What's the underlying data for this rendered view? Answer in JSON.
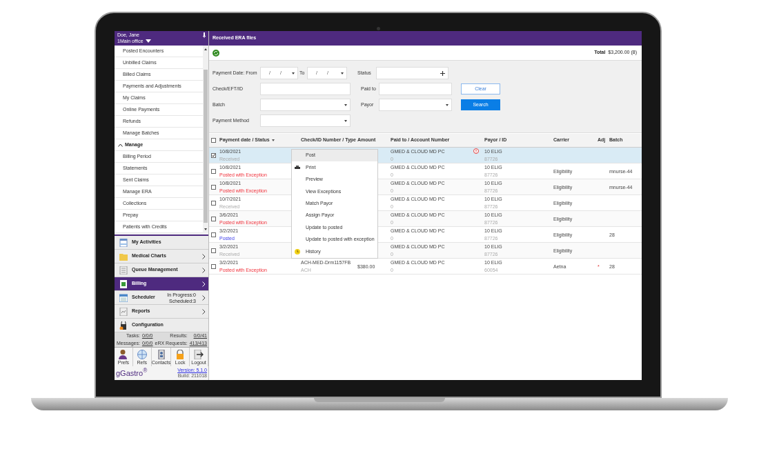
{
  "sidebar": {
    "user": "Doe, Jane",
    "office": "1Main office",
    "items": [
      {
        "kind": "item",
        "label": "Posted Encounters"
      },
      {
        "kind": "item",
        "label": "Unbilled Claims"
      },
      {
        "kind": "item",
        "label": "Billed Claims"
      },
      {
        "kind": "item",
        "label": "Payments and Adjustments"
      },
      {
        "kind": "item",
        "label": "My Claims"
      },
      {
        "kind": "item",
        "label": "Online Payments"
      },
      {
        "kind": "item",
        "label": "Refunds"
      },
      {
        "kind": "item",
        "label": "Manage Batches"
      },
      {
        "kind": "section",
        "label": "Manage",
        "expanded": true
      },
      {
        "kind": "item",
        "label": "Billing Period"
      },
      {
        "kind": "item",
        "label": "Statements"
      },
      {
        "kind": "item",
        "label": "Sent Claims"
      },
      {
        "kind": "item",
        "label": "Manage ERA"
      },
      {
        "kind": "item",
        "label": "Collections"
      },
      {
        "kind": "item",
        "label": "Prepay"
      },
      {
        "kind": "item",
        "label": "Patients with Credits"
      }
    ],
    "nav": [
      {
        "label": "My Activities",
        "selected": false,
        "arrow": false
      },
      {
        "label": "Medical Charts",
        "selected": false,
        "arrow": true
      },
      {
        "label": "Queue Management",
        "selected": false,
        "arrow": true
      },
      {
        "label": "Billing",
        "selected": true,
        "arrow": true
      },
      {
        "label": "Scheduler",
        "selected": false,
        "arrow": true,
        "in_progress": "In Progress:0",
        "scheduled": "Scheduled:3"
      },
      {
        "label": "Reports",
        "selected": false,
        "arrow": true
      },
      {
        "label": "Configuration",
        "selected": false,
        "arrow": false
      }
    ],
    "stats": [
      {
        "label": "Tasks:",
        "value": "0/0/0"
      },
      {
        "label": "Results:",
        "value": "0/0/41"
      },
      {
        "label": "Messages:",
        "value": "0/0/0"
      },
      {
        "label": "eRX Requests:",
        "value": "413/413"
      }
    ],
    "tools": [
      "Prefs",
      "Refs",
      "Contacts",
      "Lock",
      "Logout"
    ],
    "logo": "gGastro$^{®}$",
    "version": "Version: 5.1.0",
    "build": "Build: 211018"
  },
  "main": {
    "title": "Received ERA files",
    "total_label": "Total",
    "total": "$3,200.00 (8)",
    "filters": {
      "date_from_label": "Payment Date: From",
      "date_from": "/ /",
      "to_label": "To",
      "date_to": "/ /",
      "status_label": "Status",
      "check_label": "Check/EFT/ID",
      "paid_to_label": "Paid to",
      "batch_label": "Batch",
      "payor_label": "Payor",
      "method_label": "Payment Method"
    },
    "buttons": {
      "clear": "Clear",
      "search": "Search"
    },
    "all_checked": false,
    "columns": [
      "Payment date / Status",
      "Check/ID Number / Type",
      "Amount",
      "Paid to / Account Number",
      "Payor / ID",
      "Carrier",
      "Adj",
      "Batch"
    ],
    "rows": [
      {
        "checked": true,
        "date": "10/8/2021",
        "status": "Received",
        "kind": "received",
        "paid_to": "GMED & CLOUD MD PC",
        "account": "0",
        "alert": true,
        "payor": "10 ELIG",
        "payor_id": "87726"
      },
      {
        "checked": false,
        "date": "10/8/2021",
        "status": "Posted with Exception",
        "kind": "exception",
        "paid_to": "GMED & CLOUD MD PC",
        "account": "0",
        "alert": false,
        "payor": "10 ELIG",
        "payor_id": "87726",
        "carrier": "Eligibility",
        "batch": "mnurse-44"
      },
      {
        "checked": false,
        "date": "10/8/2021",
        "status": "Posted with Exception",
        "kind": "exception",
        "paid_to": "GMED & CLOUD MD PC",
        "account": "0",
        "alert": false,
        "payor": "10 ELIG",
        "payor_id": "87726",
        "carrier": "Eligibility",
        "batch": "mnurse-44"
      },
      {
        "checked": false,
        "date": "10/7/2021",
        "status": "Received",
        "kind": "received",
        "paid_to": "GMED & CLOUD MD PC",
        "account": "0",
        "alert": false,
        "payor": "10 ELIG",
        "payor_id": "87726",
        "carrier": "Eligibility"
      },
      {
        "checked": false,
        "date": "3/6/2021",
        "status": "Posted with Exception",
        "kind": "exception",
        "paid_to": "GMED & CLOUD MD PC",
        "account": "0",
        "alert": false,
        "payor": "10 ELIG",
        "payor_id": "87726",
        "carrier": "Eligibility"
      },
      {
        "checked": false,
        "date": "3/2/2021",
        "status": "Posted",
        "kind": "posted",
        "paid_to": "GMED & CLOUD MD PC",
        "account": "0",
        "alert": false,
        "payor": "10 ELIG",
        "payor_id": "87726",
        "carrier": "Eligibility",
        "batch": "28"
      },
      {
        "checked": false,
        "date": "3/2/2021",
        "status": "Received",
        "kind": "received",
        "paid_to": "GMED & CLOUD MD PC",
        "account": "0",
        "alert": false,
        "payor": "10 ELIG",
        "payor_id": "87726",
        "carrier": "Eligibility"
      },
      {
        "checked": false,
        "date": "3/2/2021",
        "status": "Posted with Exception",
        "kind": "exception",
        "check_id": "ACH-MED-Drm1157FB",
        "check_type": "ACH",
        "amount": "$380.00",
        "paid_to": "GMED & CLOUD MD PC",
        "account": "0",
        "alert": false,
        "payor": "10 ELIG",
        "payor_id": "60054",
        "carrier": "Aetna",
        "adj": "*",
        "batch": "28"
      }
    ],
    "context_menu": [
      {
        "kind": "plain",
        "label": "Post",
        "selected": true
      },
      {
        "kind": "print",
        "label": "Print",
        "selected": false
      },
      {
        "kind": "plain",
        "label": "Preview",
        "selected": false
      },
      {
        "kind": "plain",
        "label": "View Exceptions",
        "selected": false
      },
      {
        "kind": "plain",
        "label": "Match Payor",
        "selected": false
      },
      {
        "kind": "plain",
        "label": "Assign Payor",
        "selected": false
      },
      {
        "kind": "plain",
        "label": "Update to posted",
        "selected": false
      },
      {
        "kind": "plain",
        "label": "Update to posted with exception",
        "selected": false
      },
      {
        "kind": "history",
        "label": "History",
        "selected": false
      }
    ]
  }
}
